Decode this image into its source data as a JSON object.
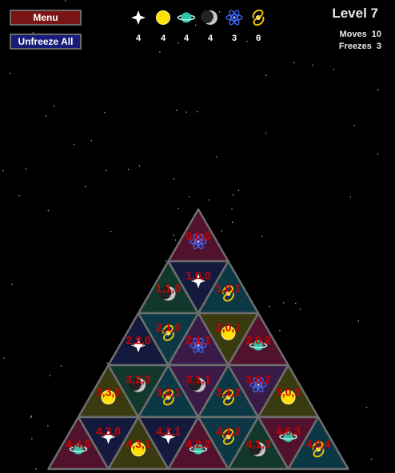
{
  "menu_button": "Menu",
  "unfreeze_button": "Unfreeze All",
  "level": "Level 7",
  "moves": {
    "label": "Moves",
    "value": "10"
  },
  "freezes": {
    "label": "Freezes",
    "value": "3"
  },
  "inventory": [
    {
      "icon": "star-icon",
      "count": "4"
    },
    {
      "icon": "sun-icon",
      "count": "4"
    },
    {
      "icon": "planet-icon",
      "count": "4"
    },
    {
      "icon": "moon-icon",
      "count": "4"
    },
    {
      "icon": "atom-icon",
      "count": "3"
    },
    {
      "icon": "galaxy-icon",
      "count": "6"
    }
  ],
  "colors": {
    "maroon": "#52122e",
    "navy": "#141a3e",
    "teal": "#0c3846",
    "green": "#12382e",
    "olive": "#3a3a10",
    "purple": "#3a1a46",
    "label": "#cc0000"
  },
  "tiles": [
    {
      "label": "0,0,0",
      "icon": "atom-icon",
      "color": "maroon"
    },
    {
      "label": "1,1,0",
      "icon": "moon-icon",
      "color": "green"
    },
    {
      "label": "1,0,0",
      "icon": "star-icon",
      "color": "navy"
    },
    {
      "label": "1,0,1",
      "icon": "galaxy-icon",
      "color": "teal"
    },
    {
      "label": "2,2,0",
      "icon": "star-icon",
      "color": "navy"
    },
    {
      "label": "2,1,0",
      "icon": "galaxy-icon",
      "color": "teal"
    },
    {
      "label": "2,1,1",
      "icon": "atom-icon",
      "color": "purple"
    },
    {
      "label": "2,0,1",
      "icon": "sun-icon",
      "color": "olive"
    },
    {
      "label": "2,0,2",
      "icon": "planet-icon",
      "color": "maroon"
    },
    {
      "label": "3,3,0",
      "icon": "sun-icon",
      "color": "olive"
    },
    {
      "label": "3,2,0",
      "icon": "moon-icon",
      "color": "green"
    },
    {
      "label": "3,2,1",
      "icon": "galaxy-icon",
      "color": "teal"
    },
    {
      "label": "3,1,1",
      "icon": "moon-icon",
      "color": "purple"
    },
    {
      "label": "3,1,2",
      "icon": "galaxy-icon",
      "color": "teal"
    },
    {
      "label": "3,0,2",
      "icon": "atom-icon",
      "color": "purple"
    },
    {
      "label": "3,0,3",
      "icon": "sun-icon",
      "color": "olive"
    },
    {
      "label": "4,4,0",
      "icon": "planet-icon",
      "color": "maroon"
    },
    {
      "label": "4,3,0",
      "icon": "star-icon",
      "color": "navy"
    },
    {
      "label": "4,3,1",
      "icon": "sun-icon",
      "color": "olive"
    },
    {
      "label": "4,2,1",
      "icon": "star-icon",
      "color": "navy"
    },
    {
      "label": "4,2,2",
      "icon": "planet-icon",
      "color": "maroon"
    },
    {
      "label": "4,1,2",
      "icon": "galaxy-icon",
      "color": "teal"
    },
    {
      "label": "4,1,3",
      "icon": "moon-icon",
      "color": "green"
    },
    {
      "label": "4,0,3",
      "icon": "planet-icon",
      "color": "maroon"
    },
    {
      "label": "4,0,4",
      "icon": "galaxy-icon",
      "color": "teal"
    }
  ]
}
